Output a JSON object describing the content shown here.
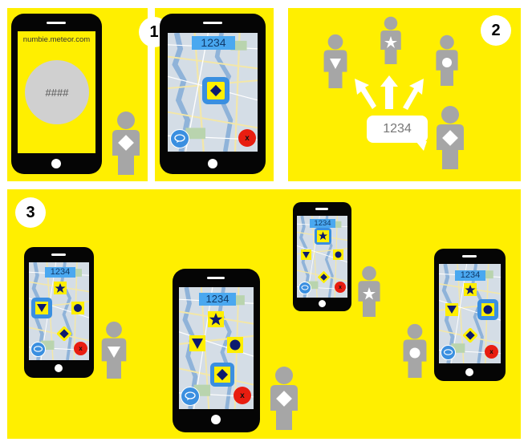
{
  "steps": [
    "1",
    "2",
    "3"
  ],
  "url_text": "numbie.meteor.com",
  "code_placeholder": "####",
  "code_value": "1234",
  "bubble_text": "1234",
  "close_label": "x",
  "colors": {
    "panel": "#ffef00",
    "person": "#a6a6a6",
    "code_bg": "#4aa8f0",
    "chat": "#3a8fe0",
    "close": "#e81d10",
    "shape": "#0d1a6e"
  },
  "icons": [
    "diamond-icon",
    "triangle-icon",
    "star-icon",
    "circle-icon",
    "chat-icon",
    "close-icon",
    "arrow-icon"
  ]
}
